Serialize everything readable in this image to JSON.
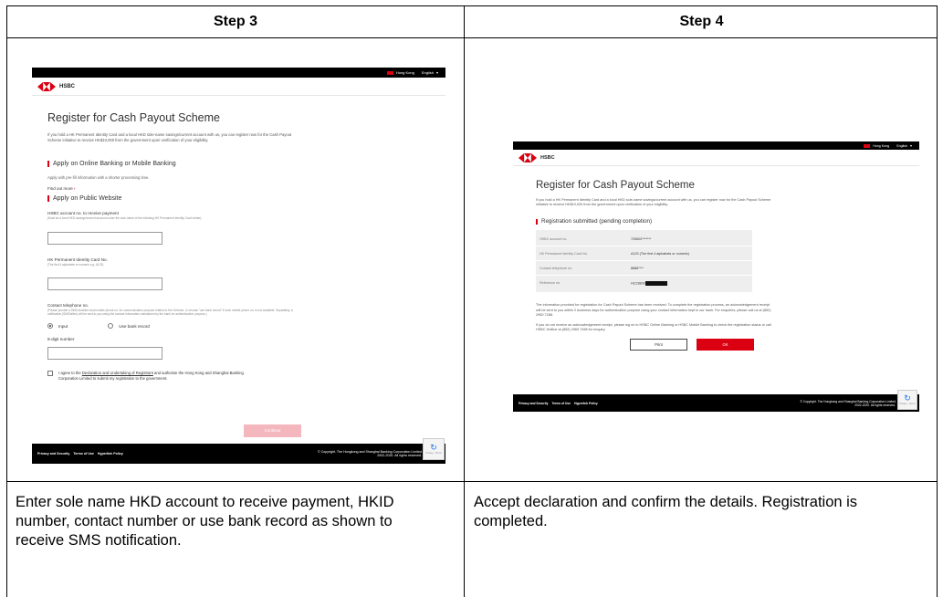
{
  "table": {
    "step3_header": "Step 3",
    "step4_header": "Step 4",
    "step3_caption": "Enter sole name HKD account to receive payment, HKID number, contact number or use bank record as shown to receive SMS notification.",
    "step4_caption": "Accept declaration and confirm the details. Registration is completed."
  },
  "site": {
    "region": "Hong Kong",
    "language": "English",
    "brand": "HSBC",
    "page_title": "Register for Cash Payout Scheme",
    "intro": "If you hold a HK Permanent Identity Card and a local HKD sole-name savings/current account with us, you can register now for the Cash Payout Scheme initiative to receive HK$10,000 from the government upon verification of your eligibility.",
    "footer_links": [
      "Privacy and Security",
      "Terms of Use",
      "Hyperlink Policy"
    ],
    "footer_copyright_1": "© Copyright. The Hongkong and Shanghai Banking Corporation Limited",
    "footer_copyright_2": "2002-2020. All rights reserved."
  },
  "step3": {
    "online_heading": "Apply on Online Banking or Mobile Banking",
    "online_desc": "Apply with pre-fill information with a shorter processing time.",
    "find_out_more": "Find out more",
    "public_heading": "Apply on Public Website",
    "account_label": "HSBC account no. to receive payment",
    "account_hint": "(Must be a local HKD savings/current account under the sole-name of the following HK Permanent Identity Card holder)",
    "hkid_label": "HK Permanent Identity Card No.",
    "hkid_hint": "(The first 4 alphabets or numeric e.g. A123)",
    "phone_label": "Contact telephone no.",
    "phone_hint": "(Please provide a SMS-enabled local mobile phone no. for communication purpose related to the Scheme, or choose \"use bank record\" if such mobile phone no. is not available. Separately, a notification (SMS/letter) will be sent to you using the contact information maintained by the bank for authentication purpose.)",
    "radio_input": "Input",
    "radio_bank": "Use bank record",
    "digit_label": "8-digit number",
    "agree_pre": "I agree to the ",
    "agree_link": "Declaration and Undertaking of Registrant",
    "agree_post": " and authorise the Hong Kong and Shanghai Banking Corporation Limited to submit my registration to the government.",
    "continue_button": "Continue"
  },
  "step4": {
    "submitted_heading": "Registration submitted (pending completion)",
    "rows": [
      {
        "label": "HSBC account no.",
        "value": "720602*******"
      },
      {
        "label": "HK Permanent Identity Card No.",
        "value": "A123  (The first 4 alphabets or numeric)"
      },
      {
        "label": "Contact telephone no.",
        "value": "8888****"
      },
      {
        "label": "Reference no.",
        "value": "HC23809"
      }
    ],
    "info_1": "The information provided for registration for Cash Payout Scheme has been received. To complete the registration process, an acknowledgement receipt will be sent to you within 2 business days for authentication purpose using your contact information kept in our bank. For enquiries, please call us at (852) 2969 7288.",
    "info_2": "If you do not receive an acknowledgement receipt, please log on to HSBC Online Banking or HSBC Mobile Banking to check the registration status or call HSBC Hotline at (852) 2969 7288 for enquiry.",
    "print_button": "Print",
    "ok_button": "OK"
  }
}
